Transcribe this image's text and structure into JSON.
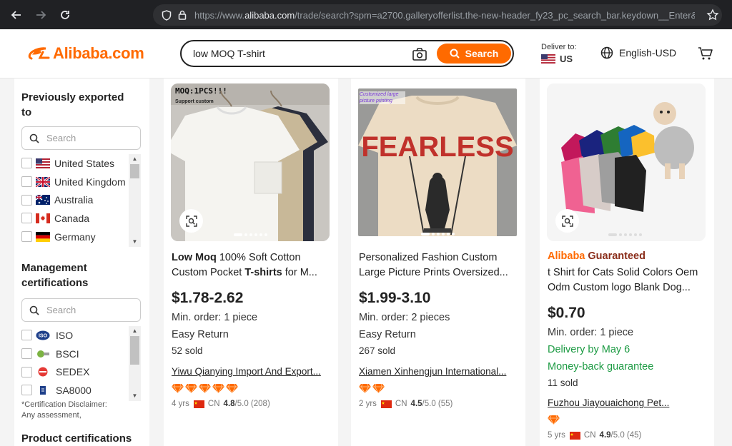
{
  "browser": {
    "url_prefix": "https://www.",
    "url_host": "alibaba.com",
    "url_rest": "/trade/search?spm=a2700.galleryofferlist.the-new-header_fy23_pc_search_bar.keydown__Enter&tab"
  },
  "header": {
    "logo_text": "Alibaba.com",
    "search_value": "low MOQ T-shirt",
    "search_button": "Search",
    "deliver_label": "Deliver to:",
    "deliver_country": "US",
    "language": "English-USD"
  },
  "sidebar": {
    "exported_title": "Previously exported to",
    "search_placeholder": "Search",
    "countries": [
      "United States",
      "United Kingdom",
      "Australia",
      "Canada",
      "Germany"
    ],
    "mgmt_title": "Management certifications",
    "certs": [
      "ISO",
      "BSCI",
      "SEDEX",
      "SA8000"
    ],
    "disclaimer_line1": "*Certification Disclaimer:",
    "disclaimer_line2": "Any assessment,",
    "product_cert_title": "Product certifications"
  },
  "products": [
    {
      "image_badge": "MOQ:1PCS!!!",
      "image_badge_sub": "Support custom",
      "title_b1": "Low Moq",
      "title_t1": " 100% Soft Cotton",
      "title_t2": "Custom Pocket ",
      "title_b2": "T-shirts",
      "title_t3": " for M...",
      "price": "$1.78-2.62",
      "min_order": "Min. order: 1 piece",
      "easy_return": "Easy Return",
      "sold": "52 sold",
      "supplier": "Yiwu Qianying Import And Export...",
      "diamonds": 5,
      "years": "4 yrs",
      "country": "CN",
      "rating": "4.8",
      "rating_max": "/5.0 (208)"
    },
    {
      "image_badge": "Customized large picture printing",
      "image_text": "FEARLESS",
      "title_line1": "Personalized Fashion Custom",
      "title_line2": "Large Picture Prints Oversized...",
      "price": "$1.99-3.10",
      "min_order": "Min. order: 2 pieces",
      "easy_return": "Easy Return",
      "sold": "267 sold",
      "supplier": "Xiamen Xinhengjun International...",
      "diamonds": 2,
      "years": "2 yrs",
      "country": "CN",
      "rating": "4.5",
      "rating_max": "/5.0 (55)"
    },
    {
      "guaranteed_a": "Alibaba",
      "guaranteed_g": " Guaranteed",
      "title_line1": "t Shirt for Cats Solid Colors Oem",
      "title_line2": "Odm Custom logo Blank Dog...",
      "price": "$0.70",
      "min_order": "Min. order: 1 piece",
      "delivery": "Delivery by May 6",
      "money_back": "Money-back guarantee",
      "sold": "11 sold",
      "supplier": "Fuzhou Jiayouaichong Pet...",
      "diamonds": 1,
      "years": "5 yrs",
      "country": "CN",
      "rating": "4.9",
      "rating_max": "/5.0 (45)"
    }
  ],
  "colors": {
    "brand": "#ff6a00",
    "green": "#1b9a42",
    "diamond": "#ff6a00"
  }
}
